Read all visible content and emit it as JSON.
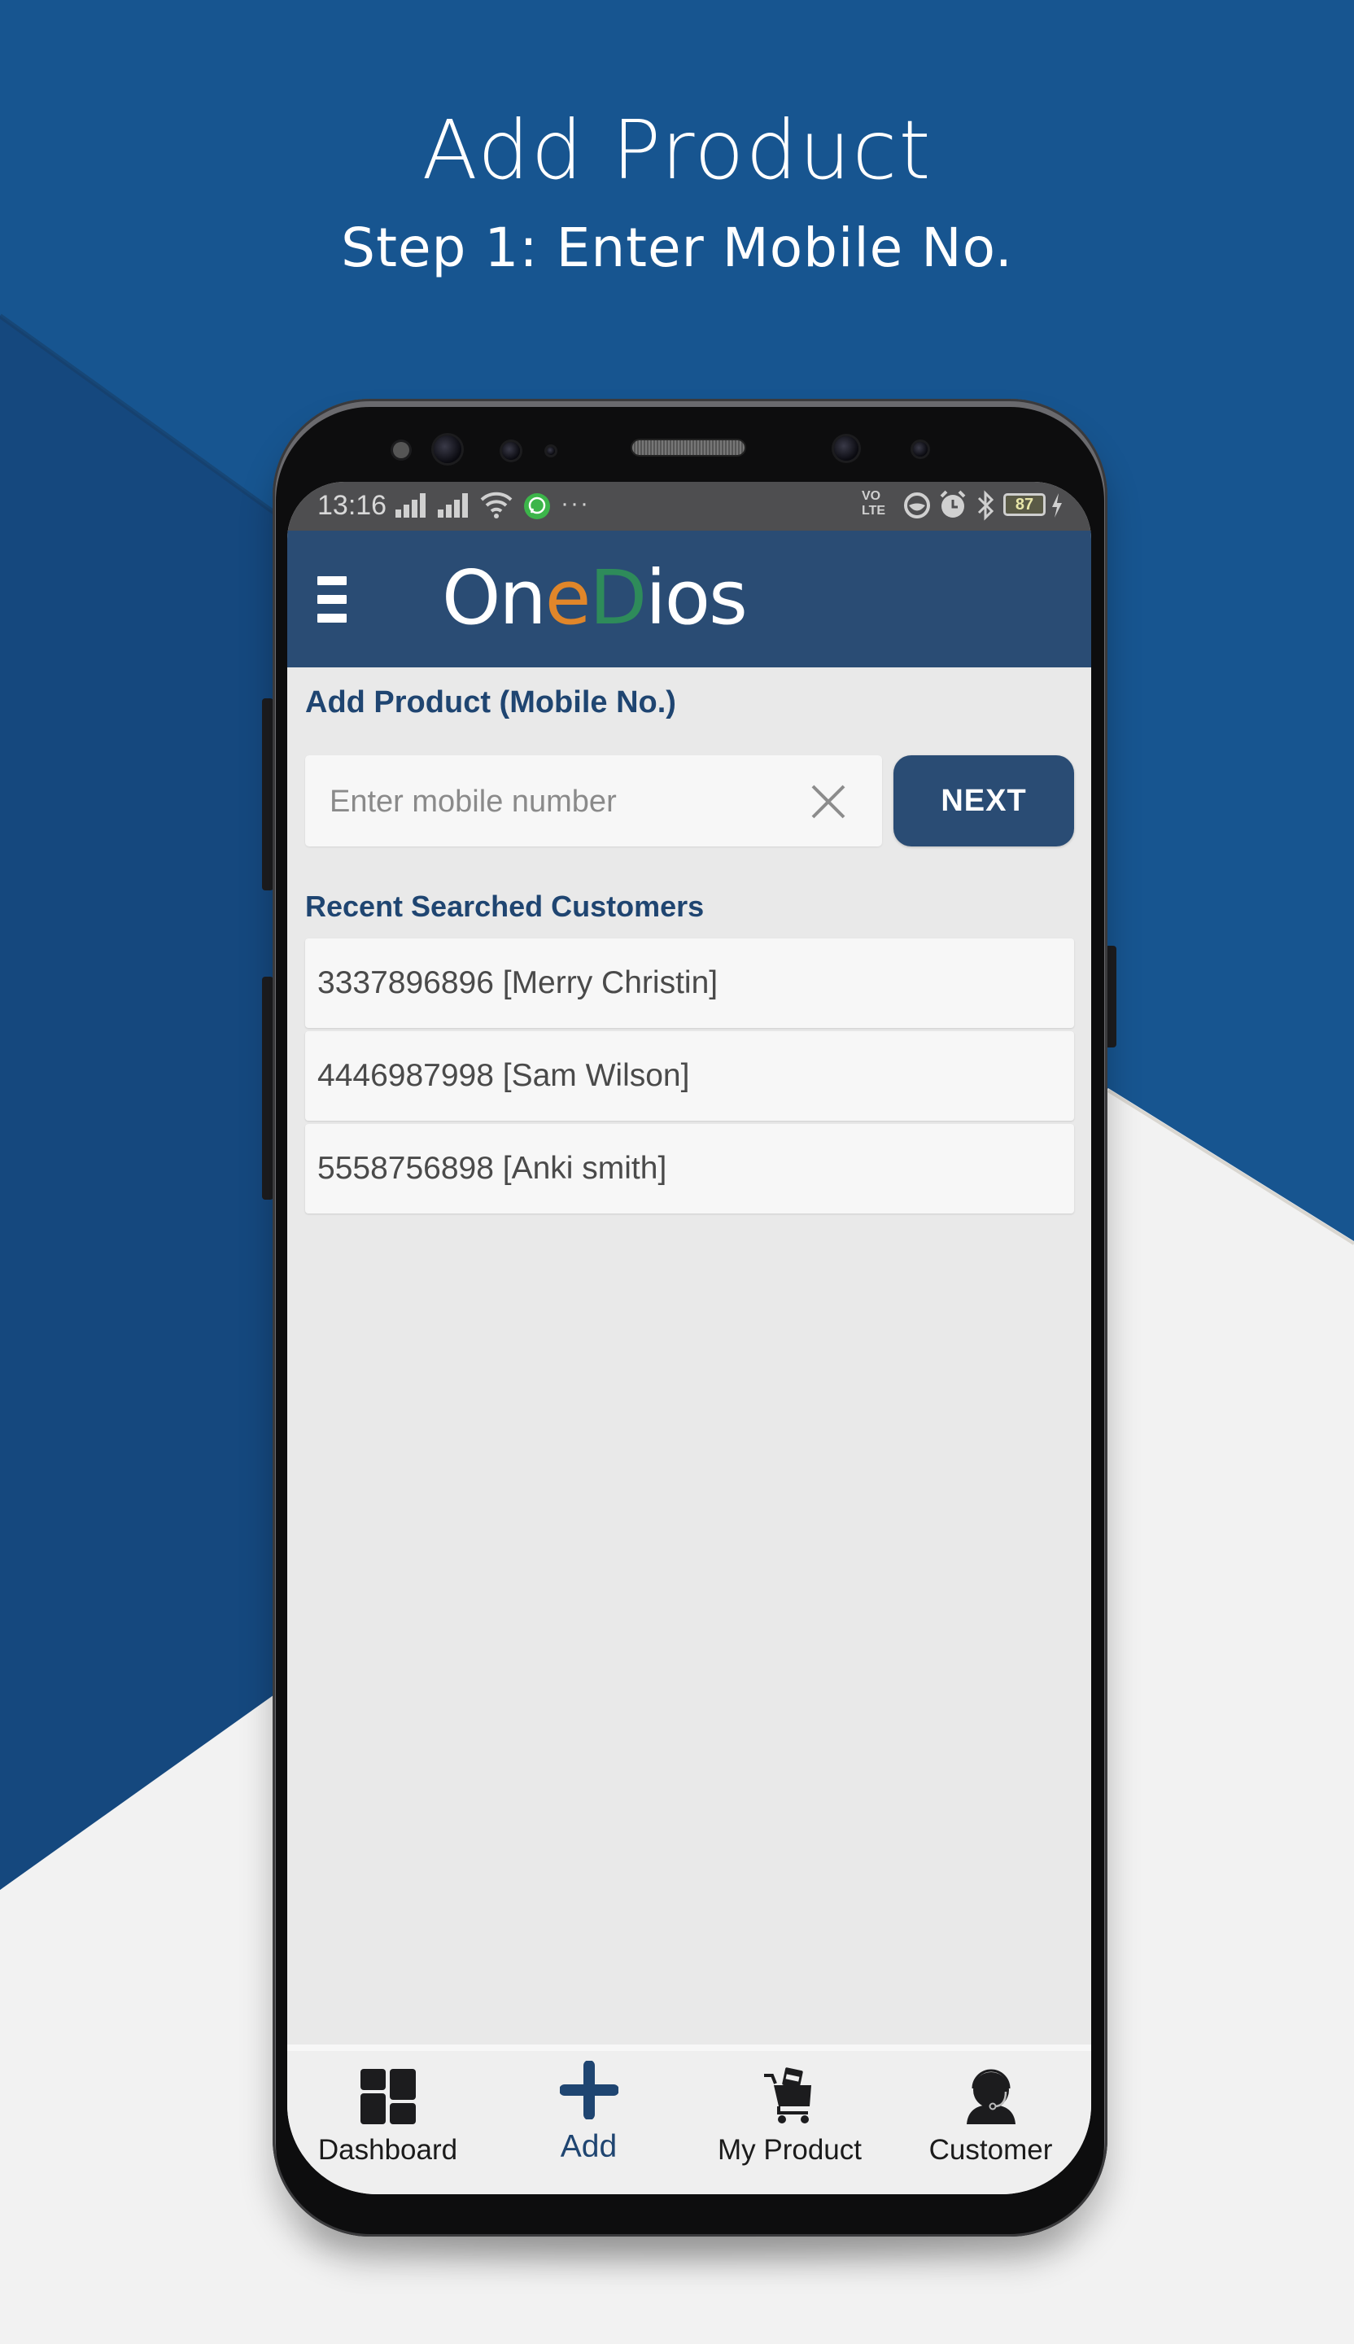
{
  "promo": {
    "title": "Add Product",
    "subtitle": "Step 1: Enter Mobile No."
  },
  "status_bar": {
    "time": "13:16",
    "battery": "87",
    "overflow": "···",
    "volte_top": "VO",
    "volte_bottom": "LTE"
  },
  "app": {
    "logo_parts": [
      "On",
      "e",
      "D",
      "ios"
    ],
    "colors": {
      "header": "#2a4c74",
      "accent_orange": "#e0862a",
      "accent_green": "#2e8b5a",
      "title_text": "#1f4571"
    }
  },
  "form": {
    "heading": "Add Product (Mobile No.)",
    "mobile_input": {
      "value": "",
      "placeholder": "Enter mobile number"
    },
    "next_label": "NEXT"
  },
  "recent": {
    "heading": "Recent Searched Customers",
    "items": [
      {
        "label": "3337896896 [Merry Christin]"
      },
      {
        "label": "4446987998 [Sam Wilson]"
      },
      {
        "label": "5558756898 [Anki smith]"
      }
    ]
  },
  "bottom_nav": {
    "items": [
      {
        "label": "Dashboard",
        "icon": "dashboard-icon",
        "active": false
      },
      {
        "label": "Add",
        "icon": "plus-icon",
        "active": true
      },
      {
        "label": "My Product",
        "icon": "cart-icon",
        "active": false
      },
      {
        "label": "Customer",
        "icon": "support-agent-icon",
        "active": false
      }
    ]
  }
}
